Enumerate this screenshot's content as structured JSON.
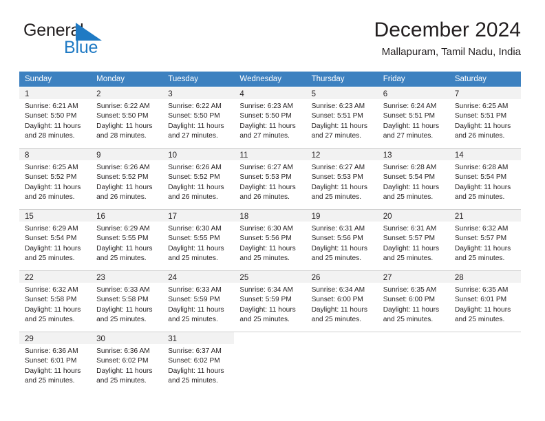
{
  "brand": {
    "name_part1": "General",
    "name_part2": "Blue",
    "flag_icon": "blue-triangle-flag-icon",
    "color_dark": "#231f20",
    "color_blue": "#1f7ac4"
  },
  "header": {
    "title": "December 2024",
    "subtitle": "Mallapuram, Tamil Nadu, India"
  },
  "calendar": {
    "header_bg": "#3d81c0",
    "day_band_bg": "#f2f2f2",
    "weekdays": [
      "Sunday",
      "Monday",
      "Tuesday",
      "Wednesday",
      "Thursday",
      "Friday",
      "Saturday"
    ],
    "weeks": [
      [
        {
          "day": "1",
          "sunrise": "Sunrise: 6:21 AM",
          "sunset": "Sunset: 5:50 PM",
          "daylight1": "Daylight: 11 hours",
          "daylight2": "and 28 minutes."
        },
        {
          "day": "2",
          "sunrise": "Sunrise: 6:22 AM",
          "sunset": "Sunset: 5:50 PM",
          "daylight1": "Daylight: 11 hours",
          "daylight2": "and 28 minutes."
        },
        {
          "day": "3",
          "sunrise": "Sunrise: 6:22 AM",
          "sunset": "Sunset: 5:50 PM",
          "daylight1": "Daylight: 11 hours",
          "daylight2": "and 27 minutes."
        },
        {
          "day": "4",
          "sunrise": "Sunrise: 6:23 AM",
          "sunset": "Sunset: 5:50 PM",
          "daylight1": "Daylight: 11 hours",
          "daylight2": "and 27 minutes."
        },
        {
          "day": "5",
          "sunrise": "Sunrise: 6:23 AM",
          "sunset": "Sunset: 5:51 PM",
          "daylight1": "Daylight: 11 hours",
          "daylight2": "and 27 minutes."
        },
        {
          "day": "6",
          "sunrise": "Sunrise: 6:24 AM",
          "sunset": "Sunset: 5:51 PM",
          "daylight1": "Daylight: 11 hours",
          "daylight2": "and 27 minutes."
        },
        {
          "day": "7",
          "sunrise": "Sunrise: 6:25 AM",
          "sunset": "Sunset: 5:51 PM",
          "daylight1": "Daylight: 11 hours",
          "daylight2": "and 26 minutes."
        }
      ],
      [
        {
          "day": "8",
          "sunrise": "Sunrise: 6:25 AM",
          "sunset": "Sunset: 5:52 PM",
          "daylight1": "Daylight: 11 hours",
          "daylight2": "and 26 minutes."
        },
        {
          "day": "9",
          "sunrise": "Sunrise: 6:26 AM",
          "sunset": "Sunset: 5:52 PM",
          "daylight1": "Daylight: 11 hours",
          "daylight2": "and 26 minutes."
        },
        {
          "day": "10",
          "sunrise": "Sunrise: 6:26 AM",
          "sunset": "Sunset: 5:52 PM",
          "daylight1": "Daylight: 11 hours",
          "daylight2": "and 26 minutes."
        },
        {
          "day": "11",
          "sunrise": "Sunrise: 6:27 AM",
          "sunset": "Sunset: 5:53 PM",
          "daylight1": "Daylight: 11 hours",
          "daylight2": "and 26 minutes."
        },
        {
          "day": "12",
          "sunrise": "Sunrise: 6:27 AM",
          "sunset": "Sunset: 5:53 PM",
          "daylight1": "Daylight: 11 hours",
          "daylight2": "and 25 minutes."
        },
        {
          "day": "13",
          "sunrise": "Sunrise: 6:28 AM",
          "sunset": "Sunset: 5:54 PM",
          "daylight1": "Daylight: 11 hours",
          "daylight2": "and 25 minutes."
        },
        {
          "day": "14",
          "sunrise": "Sunrise: 6:28 AM",
          "sunset": "Sunset: 5:54 PM",
          "daylight1": "Daylight: 11 hours",
          "daylight2": "and 25 minutes."
        }
      ],
      [
        {
          "day": "15",
          "sunrise": "Sunrise: 6:29 AM",
          "sunset": "Sunset: 5:54 PM",
          "daylight1": "Daylight: 11 hours",
          "daylight2": "and 25 minutes."
        },
        {
          "day": "16",
          "sunrise": "Sunrise: 6:29 AM",
          "sunset": "Sunset: 5:55 PM",
          "daylight1": "Daylight: 11 hours",
          "daylight2": "and 25 minutes."
        },
        {
          "day": "17",
          "sunrise": "Sunrise: 6:30 AM",
          "sunset": "Sunset: 5:55 PM",
          "daylight1": "Daylight: 11 hours",
          "daylight2": "and 25 minutes."
        },
        {
          "day": "18",
          "sunrise": "Sunrise: 6:30 AM",
          "sunset": "Sunset: 5:56 PM",
          "daylight1": "Daylight: 11 hours",
          "daylight2": "and 25 minutes."
        },
        {
          "day": "19",
          "sunrise": "Sunrise: 6:31 AM",
          "sunset": "Sunset: 5:56 PM",
          "daylight1": "Daylight: 11 hours",
          "daylight2": "and 25 minutes."
        },
        {
          "day": "20",
          "sunrise": "Sunrise: 6:31 AM",
          "sunset": "Sunset: 5:57 PM",
          "daylight1": "Daylight: 11 hours",
          "daylight2": "and 25 minutes."
        },
        {
          "day": "21",
          "sunrise": "Sunrise: 6:32 AM",
          "sunset": "Sunset: 5:57 PM",
          "daylight1": "Daylight: 11 hours",
          "daylight2": "and 25 minutes."
        }
      ],
      [
        {
          "day": "22",
          "sunrise": "Sunrise: 6:32 AM",
          "sunset": "Sunset: 5:58 PM",
          "daylight1": "Daylight: 11 hours",
          "daylight2": "and 25 minutes."
        },
        {
          "day": "23",
          "sunrise": "Sunrise: 6:33 AM",
          "sunset": "Sunset: 5:58 PM",
          "daylight1": "Daylight: 11 hours",
          "daylight2": "and 25 minutes."
        },
        {
          "day": "24",
          "sunrise": "Sunrise: 6:33 AM",
          "sunset": "Sunset: 5:59 PM",
          "daylight1": "Daylight: 11 hours",
          "daylight2": "and 25 minutes."
        },
        {
          "day": "25",
          "sunrise": "Sunrise: 6:34 AM",
          "sunset": "Sunset: 5:59 PM",
          "daylight1": "Daylight: 11 hours",
          "daylight2": "and 25 minutes."
        },
        {
          "day": "26",
          "sunrise": "Sunrise: 6:34 AM",
          "sunset": "Sunset: 6:00 PM",
          "daylight1": "Daylight: 11 hours",
          "daylight2": "and 25 minutes."
        },
        {
          "day": "27",
          "sunrise": "Sunrise: 6:35 AM",
          "sunset": "Sunset: 6:00 PM",
          "daylight1": "Daylight: 11 hours",
          "daylight2": "and 25 minutes."
        },
        {
          "day": "28",
          "sunrise": "Sunrise: 6:35 AM",
          "sunset": "Sunset: 6:01 PM",
          "daylight1": "Daylight: 11 hours",
          "daylight2": "and 25 minutes."
        }
      ],
      [
        {
          "day": "29",
          "sunrise": "Sunrise: 6:36 AM",
          "sunset": "Sunset: 6:01 PM",
          "daylight1": "Daylight: 11 hours",
          "daylight2": "and 25 minutes."
        },
        {
          "day": "30",
          "sunrise": "Sunrise: 6:36 AM",
          "sunset": "Sunset: 6:02 PM",
          "daylight1": "Daylight: 11 hours",
          "daylight2": "and 25 minutes."
        },
        {
          "day": "31",
          "sunrise": "Sunrise: 6:37 AM",
          "sunset": "Sunset: 6:02 PM",
          "daylight1": "Daylight: 11 hours",
          "daylight2": "and 25 minutes."
        },
        {
          "day": "",
          "sunrise": "",
          "sunset": "",
          "daylight1": "",
          "daylight2": ""
        },
        {
          "day": "",
          "sunrise": "",
          "sunset": "",
          "daylight1": "",
          "daylight2": ""
        },
        {
          "day": "",
          "sunrise": "",
          "sunset": "",
          "daylight1": "",
          "daylight2": ""
        },
        {
          "day": "",
          "sunrise": "",
          "sunset": "",
          "daylight1": "",
          "daylight2": ""
        }
      ]
    ]
  }
}
